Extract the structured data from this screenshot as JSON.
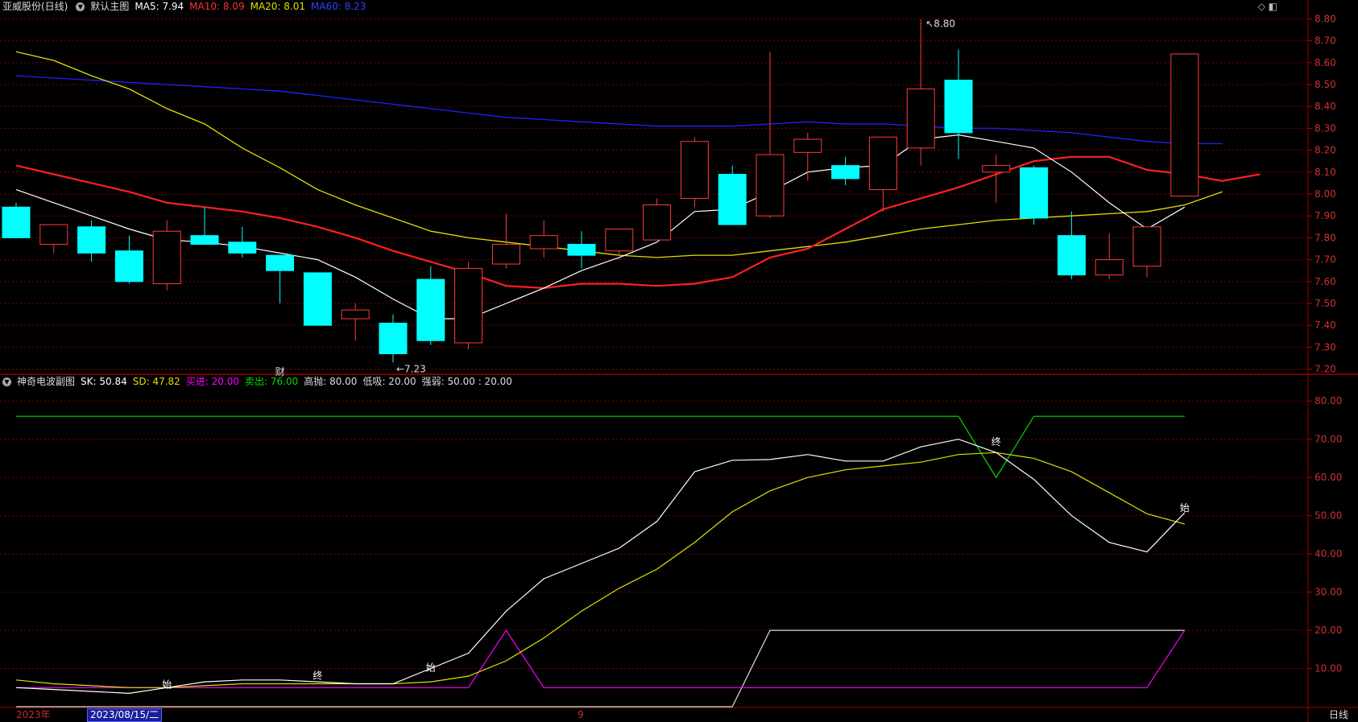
{
  "main_header": {
    "stock_name": "亚威股份(日线)",
    "chart_name": "默认主图",
    "ma5": "MA5: 7.94",
    "ma10": "MA10: 8.09",
    "ma20": "MA20: 8.01",
    "ma60": "MA60: 8.23"
  },
  "sub_header": {
    "name": "神奇电波副图",
    "sk": "SK: 50.84",
    "sd": "SD: 47.82",
    "buy": "买进: 20.00",
    "sell": "卖出: 76.00",
    "high": "高抛: 80.00",
    "low": "低吸: 20.00",
    "strength": "强弱: 50.00 : 20.00"
  },
  "bottom": {
    "year": "2023年",
    "date": "2023/08/15/二",
    "month": "9",
    "period_button": "日线"
  },
  "icons": {
    "top_right": "◇ ◧"
  },
  "colors": {
    "up": "#ff3b3b",
    "down": "#00ffff",
    "ma5": "#ffffff",
    "ma10": "#ff2020",
    "ma20": "#e0e000",
    "ma60": "#2020ff",
    "sk": "#ffffff",
    "sd": "#e0e000",
    "buy": "#ff00ff",
    "sell": "#00dd00",
    "grid": "#7a0000"
  },
  "chart_data": [
    {
      "type": "candlestick",
      "y_ticks": [
        "8.80",
        "8.70",
        "8.60",
        "8.50",
        "8.40",
        "8.30",
        "8.20",
        "8.10",
        "8.00",
        "7.90",
        "7.80",
        "7.70",
        "7.60",
        "7.50",
        "7.40",
        "7.30",
        "7.20"
      ],
      "ylim": [
        7.18,
        8.82
      ],
      "candles": [
        {
          "o": 7.94,
          "h": 7.96,
          "l": 7.8,
          "c": 7.8
        },
        {
          "o": 7.77,
          "h": 7.86,
          "l": 7.73,
          "c": 7.86
        },
        {
          "o": 7.85,
          "h": 7.88,
          "l": 7.69,
          "c": 7.73
        },
        {
          "o": 7.74,
          "h": 7.81,
          "l": 7.59,
          "c": 7.6
        },
        {
          "o": 7.59,
          "h": 7.88,
          "l": 7.56,
          "c": 7.83
        },
        {
          "o": 7.81,
          "h": 7.94,
          "l": 7.77,
          "c": 7.77
        },
        {
          "o": 7.78,
          "h": 7.85,
          "l": 7.71,
          "c": 7.73
        },
        {
          "o": 7.72,
          "h": 7.72,
          "l": 7.5,
          "c": 7.65
        },
        {
          "o": 7.64,
          "h": 7.64,
          "l": 7.4,
          "c": 7.4
        },
        {
          "o": 7.43,
          "h": 7.5,
          "l": 7.33,
          "c": 7.47
        },
        {
          "o": 7.41,
          "h": 7.45,
          "l": 7.23,
          "c": 7.27
        },
        {
          "o": 7.61,
          "h": 7.67,
          "l": 7.31,
          "c": 7.33
        },
        {
          "o": 7.32,
          "h": 7.69,
          "l": 7.29,
          "c": 7.66
        },
        {
          "o": 7.68,
          "h": 7.91,
          "l": 7.66,
          "c": 7.77
        },
        {
          "o": 7.75,
          "h": 7.88,
          "l": 7.71,
          "c": 7.81
        },
        {
          "o": 7.77,
          "h": 7.83,
          "l": 7.66,
          "c": 7.72
        },
        {
          "o": 7.74,
          "h": 7.84,
          "l": 7.7,
          "c": 7.84
        },
        {
          "o": 7.79,
          "h": 7.98,
          "l": 7.79,
          "c": 7.95
        },
        {
          "o": 7.98,
          "h": 8.26,
          "l": 7.94,
          "c": 8.24
        },
        {
          "o": 8.09,
          "h": 8.13,
          "l": 7.86,
          "c": 7.86
        },
        {
          "o": 7.9,
          "h": 8.65,
          "l": 7.89,
          "c": 8.18
        },
        {
          "o": 8.19,
          "h": 8.28,
          "l": 8.06,
          "c": 8.25
        },
        {
          "o": 8.13,
          "h": 8.17,
          "l": 8.04,
          "c": 8.07
        },
        {
          "o": 8.02,
          "h": 8.26,
          "l": 7.92,
          "c": 8.26
        },
        {
          "o": 8.21,
          "h": 8.8,
          "l": 8.13,
          "c": 8.48
        },
        {
          "o": 8.52,
          "h": 8.66,
          "l": 8.16,
          "c": 8.28
        },
        {
          "o": 8.1,
          "h": 8.18,
          "l": 7.96,
          "c": 8.13
        },
        {
          "o": 8.12,
          "h": 8.13,
          "l": 7.86,
          "c": 7.89
        },
        {
          "o": 7.81,
          "h": 7.92,
          "l": 7.61,
          "c": 7.63
        },
        {
          "o": 7.63,
          "h": 7.82,
          "l": 7.61,
          "c": 7.7
        },
        {
          "o": 7.67,
          "h": 7.85,
          "l": 7.62,
          "c": 7.85
        },
        {
          "o": 7.99,
          "h": 8.64,
          "l": 7.99,
          "c": 8.64
        }
      ],
      "ma5": [
        8.02,
        7.96,
        7.9,
        7.84,
        7.79,
        7.78,
        7.76,
        7.73,
        7.7,
        7.62,
        7.52,
        7.43,
        7.43,
        7.5,
        7.57,
        7.65,
        7.71,
        7.78,
        7.92,
        7.93,
        8.01,
        8.1,
        8.12,
        8.13,
        8.25,
        8.27,
        8.24,
        8.21,
        8.1,
        7.96,
        7.84,
        7.94
      ],
      "ma10": [
        8.13,
        8.09,
        8.05,
        8.01,
        7.96,
        7.94,
        7.92,
        7.89,
        7.85,
        7.8,
        7.74,
        7.69,
        7.64,
        7.58,
        7.57,
        7.59,
        7.59,
        7.58,
        7.59,
        7.62,
        7.71,
        7.75,
        7.84,
        7.93,
        7.98,
        8.03,
        8.09,
        8.15,
        8.17,
        8.17,
        8.11,
        8.09,
        8.06,
        8.09
      ],
      "ma20": [
        8.65,
        8.61,
        8.54,
        8.48,
        8.39,
        8.32,
        8.21,
        8.12,
        8.02,
        7.95,
        7.89,
        7.83,
        7.8,
        7.78,
        7.76,
        7.74,
        7.72,
        7.71,
        7.72,
        7.72,
        7.74,
        7.76,
        7.78,
        7.81,
        7.84,
        7.86,
        7.88,
        7.89,
        7.9,
        7.91,
        7.92,
        7.95,
        8.01
      ],
      "ma60": [
        8.54,
        8.53,
        8.52,
        8.51,
        8.5,
        8.49,
        8.48,
        8.47,
        8.45,
        8.43,
        8.41,
        8.39,
        8.37,
        8.35,
        8.34,
        8.33,
        8.32,
        8.31,
        8.31,
        8.31,
        8.32,
        8.33,
        8.32,
        8.32,
        8.31,
        8.3,
        8.3,
        8.29,
        8.28,
        8.26,
        8.24,
        8.23,
        8.23
      ],
      "annotations": [
        {
          "text": "8.80",
          "candle": 24,
          "value": 8.8,
          "arrow": "up"
        },
        {
          "text": "←7.23",
          "candle": 10,
          "value": 7.23,
          "arrow": "down"
        },
        {
          "text": "财",
          "candle": 7,
          "value": 7.18
        }
      ]
    },
    {
      "type": "line",
      "y_ticks": [
        "80.00",
        "70.00",
        "60.00",
        "50.00",
        "40.00",
        "30.00",
        "20.00",
        "10.00"
      ],
      "ylim": [
        0,
        83
      ],
      "series": [
        {
          "name": "SK",
          "values": [
            5,
            4.5,
            4,
            3.5,
            5,
            6.5,
            7,
            7,
            6.5,
            6,
            6,
            10,
            14,
            25,
            33.5,
            37.5,
            41.5,
            48.5,
            61.5,
            64.5,
            64.7,
            66,
            64.3,
            64.3,
            68,
            70,
            66.5,
            59.5,
            50,
            43,
            40.5,
            50.8
          ]
        },
        {
          "name": "SD",
          "values": [
            7,
            6,
            5.5,
            5,
            5,
            5.5,
            6,
            6,
            6,
            6,
            6,
            6.5,
            8,
            12,
            18,
            25,
            31,
            36,
            43,
            51,
            56.5,
            60,
            62,
            63,
            64,
            66,
            66.5,
            65,
            61.5,
            56,
            50.5,
            47.8
          ]
        },
        {
          "name": "买进",
          "values": [
            5,
            5,
            5,
            5,
            5,
            5,
            5,
            5,
            5,
            5,
            5,
            5,
            5,
            20,
            5,
            5,
            5,
            5,
            5,
            5,
            5,
            5,
            5,
            5,
            5,
            5,
            5,
            5,
            5,
            5,
            5,
            20
          ]
        },
        {
          "name": "卖出",
          "values": [
            76,
            76,
            76,
            76,
            76,
            76,
            76,
            76,
            76,
            76,
            76,
            76,
            76,
            76,
            76,
            76,
            76,
            76,
            76,
            76,
            76,
            76,
            76,
            76,
            76,
            76,
            60,
            76,
            76,
            76,
            76,
            76
          ]
        },
        {
          "name": "强弱",
          "values": [
            0,
            0,
            0,
            0,
            0,
            0,
            0,
            0,
            0,
            0,
            0,
            0,
            0,
            0,
            0,
            0,
            0,
            0,
            0,
            0,
            20,
            20,
            20,
            20,
            20,
            20,
            20,
            20,
            20,
            20,
            20,
            20
          ]
        }
      ],
      "annotations": [
        {
          "text": "始",
          "candle": 4,
          "value": 4.5
        },
        {
          "text": "终",
          "candle": 8,
          "value": 6.8
        },
        {
          "text": "始",
          "candle": 11,
          "value": 9
        },
        {
          "text": "终",
          "candle": 26,
          "value": 68
        },
        {
          "text": "始",
          "candle": 31,
          "value": 50.8
        }
      ]
    }
  ]
}
